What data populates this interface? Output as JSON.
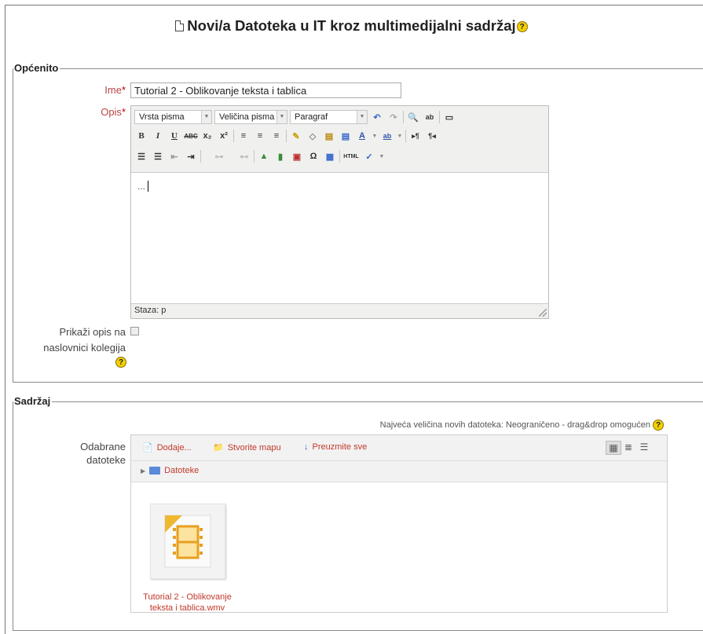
{
  "page": {
    "title": "Novi/a Datoteka u IT kroz multimedijalni sadržaj"
  },
  "general": {
    "legend": "Općenito",
    "name_label": "Ime",
    "name_value": "Tutorial 2 - Oblikovanje teksta i tablica",
    "desc_label": "Opis",
    "required_mark": "*",
    "show_desc_label_line1": "Prikaži opis na",
    "show_desc_label_line2": "naslovnici kolegija"
  },
  "editor": {
    "font_family": "Vrsta pisma",
    "font_size": "Veličina pisma",
    "format": "Paragraf",
    "content": "...",
    "status_path": "Staza: p"
  },
  "content_section": {
    "legend": "Sadržaj",
    "files_label_line1": "Odabrane",
    "files_label_line2": "datoteke",
    "max_size_text": "Najveća veličina novih datoteka: Neograničeno - drag&drop omogućen",
    "add_label": "Dodaje...",
    "create_folder_label": "Stvorite mapu",
    "download_all_label": "Preuzmite sve",
    "path_root": "Datoteke",
    "file_name_line1": "Tutorial 2 - Oblikovanje",
    "file_name_line2": "teksta i tablica.wmv"
  },
  "icons": {
    "help": "help-icon",
    "page": "page-icon",
    "folder": "folder-icon",
    "video_file": "video-file-icon"
  },
  "colors": {
    "link_red": "#c0392b",
    "required_red": "#b00",
    "help_yellow": "#f3d000"
  }
}
